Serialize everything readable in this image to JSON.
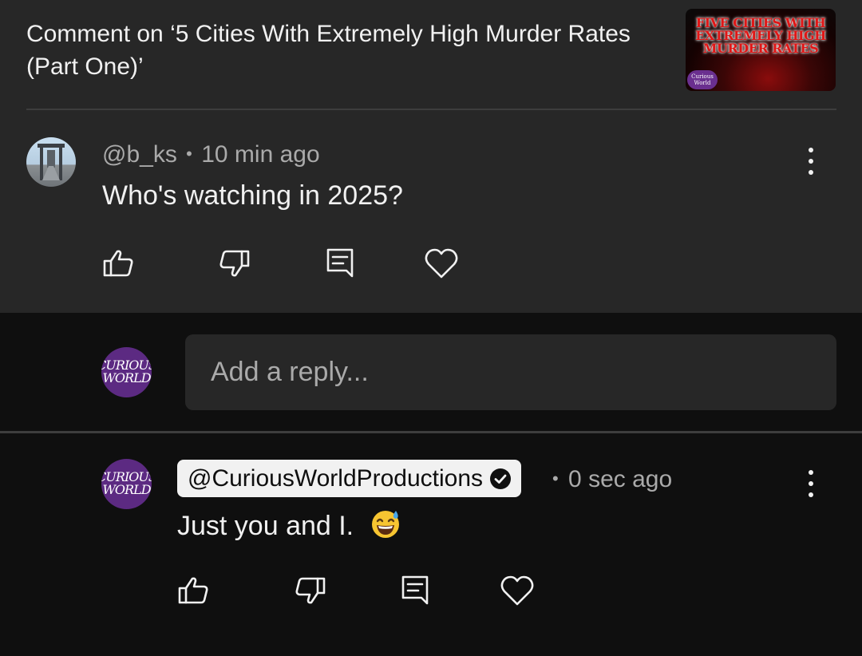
{
  "header": {
    "title": "Comment on ‘5 Cities With Extremely High Murder Rates (Part One)’",
    "thumbnail_text": "Five Cities With Extremely High Murder Rates",
    "thumbnail_logo_text": "Curious World"
  },
  "comment": {
    "handle": "@b_ks",
    "separator": "•",
    "time": "10 min ago",
    "text": "Who's watching in 2025?"
  },
  "reply_input": {
    "placeholder": "Add a reply...",
    "avatar_text": "CURIOUS WORLD"
  },
  "reply": {
    "handle": "@CuriousWorldProductions",
    "separator": "•",
    "time": "0 sec ago",
    "text": "Just you and I.",
    "emoji": "grinning-face-with-sweat",
    "avatar_text": "CURIOUS WORLD",
    "verified": true
  },
  "actions": [
    "like-icon",
    "dislike-icon",
    "reply-icon",
    "heart-icon"
  ],
  "colors": {
    "top_panel_bg": "#272727",
    "page_bg": "#0f0f0f",
    "text_primary": "#f1f1f1",
    "text_secondary": "#aaaaaa",
    "avatar_purple": "#5c2a82",
    "thumbnail_red": "#e01616"
  }
}
